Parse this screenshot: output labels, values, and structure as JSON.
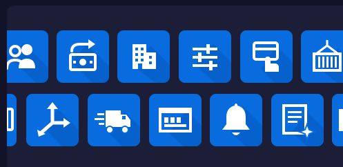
{
  "theme": {
    "page_background": "#121328",
    "panel_background": "#1c1d36",
    "tile_color": "#086cdf",
    "tile_shadow_color": "#0559bd",
    "icon_color": "#ffffff"
  },
  "icon_grid": {
    "rows": [
      {
        "tiles": [
          {
            "icon": "users-group-icon"
          },
          {
            "icon": "money-exchange-icon"
          },
          {
            "icon": "office-building-icon"
          },
          {
            "icon": "sliders-settings-icon"
          },
          {
            "icon": "card-payment-tap-icon"
          },
          {
            "icon": "shipping-container-icon"
          }
        ]
      },
      {
        "tiles": [
          {
            "icon": "partial-tile-icon"
          },
          {
            "icon": "three-way-arrows-icon"
          },
          {
            "icon": "fast-delivery-truck-icon"
          },
          {
            "icon": "browser-dashboard-icon"
          },
          {
            "icon": "notification-bell-icon"
          },
          {
            "icon": "document-sparkle-icon"
          },
          {
            "icon": "partial-tile-icon"
          }
        ]
      }
    ]
  }
}
